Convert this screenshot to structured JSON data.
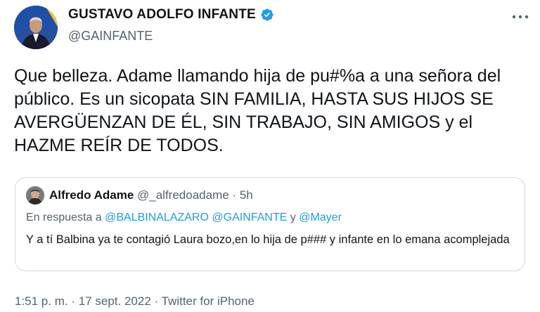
{
  "author": {
    "name": "GUSTAVO ADOLFO INFANTE",
    "handle": "@GAINFANTE"
  },
  "tweet": {
    "text": "Que belleza. Adame llamando hija de pu#%a a una señora del público. Es un sicopata   SIN FAMILIA, HASTA SUS HIJOS SE AVERGÜENZAN DE ÉL, SIN TRABAJO, SIN AMIGOS y el HAZME REÍR DE TODOS."
  },
  "quote": {
    "name": "Alfredo Adame",
    "handle": "@_alfredoadame",
    "separator": "·",
    "time": "5h",
    "reply_prefix": "En respuesta a",
    "reply_mentions": [
      "@BALBINALAZARO",
      "@GAINFANTE"
    ],
    "reply_joiner": "y",
    "reply_last": "@Mayer",
    "text": "Y a tí Balbina ya te contagió Laura bozo,en lo hija de p### y infante en lo emana acomplejada"
  },
  "footer": {
    "time": "1:51 p. m.",
    "date": "17 sept. 2022",
    "source": "Twitter for iPhone",
    "separator": "·"
  },
  "colors": {
    "accent": "#1d9bf0",
    "secondary_text": "#536471",
    "border": "#cfd9de"
  },
  "icons": {
    "verified": "verified-badge-icon",
    "more": "more-options-icon"
  }
}
